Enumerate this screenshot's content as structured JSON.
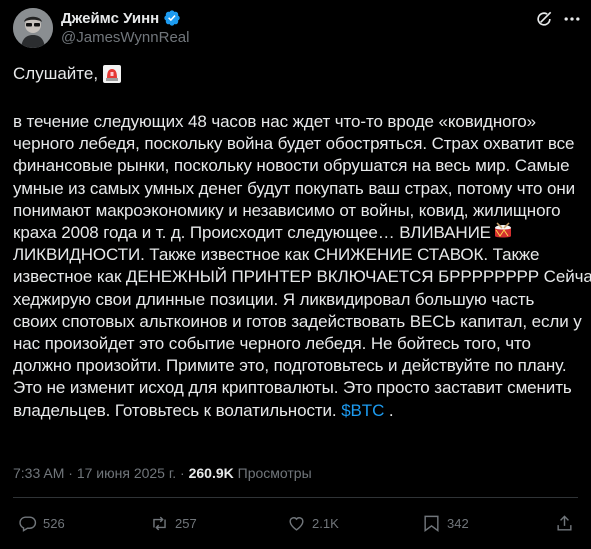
{
  "author": {
    "name": "Джеймс Уинн",
    "handle": "@JamesWynnReal",
    "verified": true
  },
  "icons": {
    "verified": "verified-badge-icon",
    "grok": "grok-icon",
    "more": "more-options-icon",
    "siren": "rotating-light-emoji",
    "drum": "drum-emoji",
    "reply": "reply-icon",
    "repost": "repost-icon",
    "like": "like-icon",
    "views": "views-icon",
    "share": "share-icon"
  },
  "tweet": {
    "greeting": "Слушайте,",
    "lines": [
      "в течение следующих 48 часов нас ждет что-то вроде «ковидного»",
      "черного лебедя, поскольку война будет обостряться. Страх охватит все",
      "финансовые рынки, поскольку новости обрушатся на весь мир. Самые",
      "умные из самых умных денег будут покупать ваш страх, потому что они",
      "понимают макроэкономику и независимо от войны, ковид, жилищного",
      "краха 2008 года и т. д. Происходит следующее… ВЛИВАНИЕ",
      "ЛИКВИДНОСТИ. Также известное как СНИЖЕНИЕ СТАВОК. Также",
      "известное как ДЕНЕЖНЫЙ ПРИНТЕР ВКЛЮЧАЕТСЯ БРРРРРРРР Сейчас я",
      "хеджирую свои длинные позиции. Я ликвидировал большую часть",
      "своих спотовых альткоинов и готов задействовать ВЕСЬ капитал, если у",
      "нас произойдет это событие черного лебедя. Не бойтесь того, что",
      "должно произойти. Примите это, подготовьтесь и действуйте по плану.",
      "Это не изменит исход для криптовалюты. Это просто заставит сменить",
      "владельцев. Готовьтесь к волатильности."
    ],
    "cashtag": "$BTC",
    "end_punct": " ."
  },
  "meta": {
    "time": "7:33 AM",
    "separator": " · ",
    "date": "17 июня 2025 г.",
    "views_count": "260.9K",
    "views_label": "Просмотры"
  },
  "actions": {
    "replies": "526",
    "reposts": "257",
    "likes": "2.1K",
    "bookmarks": "342"
  },
  "colors": {
    "background": "#000000",
    "text": "#e7e9ea",
    "muted": "#71767b",
    "accent": "#1d9bf0"
  }
}
